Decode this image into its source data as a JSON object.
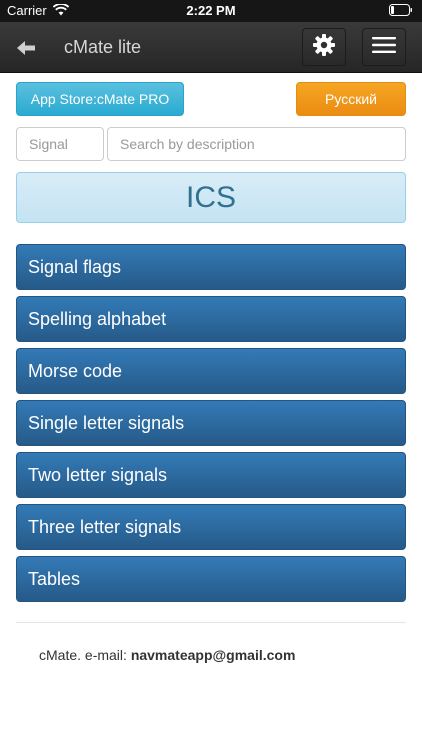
{
  "status_bar": {
    "carrier": "Carrier",
    "time": "2:22 PM",
    "icons": [
      "wifi-icon",
      "battery-icon"
    ]
  },
  "nav": {
    "title": "cMate lite",
    "icons": [
      "back-arrow-icon",
      "gear-icon",
      "hamburger-menu-icon"
    ]
  },
  "actions": {
    "app_store_label": "App Store:cMate PRO",
    "language_label": "Русский"
  },
  "search": {
    "signal_placeholder": "Signal",
    "description_placeholder": "Search by description"
  },
  "banner": {
    "title": "ICS"
  },
  "menu": {
    "items": [
      {
        "label": "Signal flags"
      },
      {
        "label": "Spelling alphabet"
      },
      {
        "label": "Morse code"
      },
      {
        "label": "Single letter signals"
      },
      {
        "label": "Two letter signals"
      },
      {
        "label": "Three letter signals"
      },
      {
        "label": "Tables"
      }
    ]
  },
  "footer": {
    "prefix": "cMate. e-mail: ",
    "email": "navmateapp@gmail.com"
  },
  "colors": {
    "nav_bg": "#2e2e2e",
    "store_button": "#5bc0de",
    "language_button": "#f0a020",
    "banner_bg": "#d9edf7",
    "banner_text": "#31708f",
    "menu_item": "#2e6da4"
  }
}
